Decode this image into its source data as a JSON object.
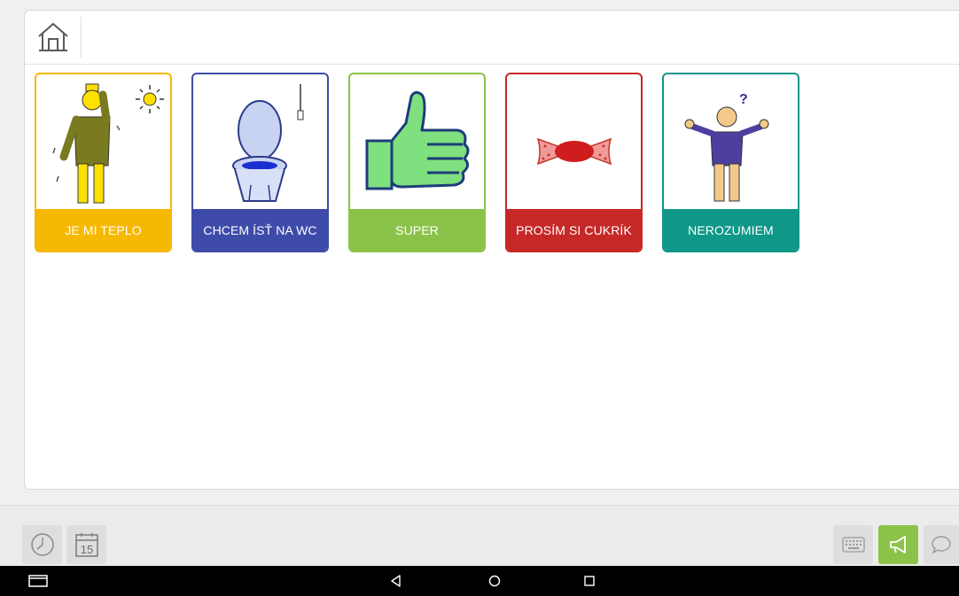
{
  "cards": [
    {
      "label": "JE MI TEPLO",
      "color": "#f6b800"
    },
    {
      "label": "CHCEM ÍSŤ NA WC",
      "color": "#3e4ba8"
    },
    {
      "label": "SUPER",
      "color": "#8bc34a"
    },
    {
      "label": "PROSÍM SI CUKRÍK",
      "color": "#c62828"
    },
    {
      "label": "NEROZUMIEM",
      "color": "#0f9788"
    }
  ],
  "calendar": {
    "day": "15"
  },
  "icons": {
    "home": "home-icon",
    "clock": "clock-icon",
    "calendar": "calendar-icon",
    "keyboard": "keyboard-icon",
    "speak": "megaphone-icon",
    "speech": "speech-bubble-icon",
    "nav_recents": "recents-icon",
    "nav_back": "back-icon",
    "nav_home": "circle-home-icon",
    "nav_overview": "square-icon"
  },
  "colors": {
    "speak_button_bg": "#8bc34a"
  },
  "question_mark": "?"
}
